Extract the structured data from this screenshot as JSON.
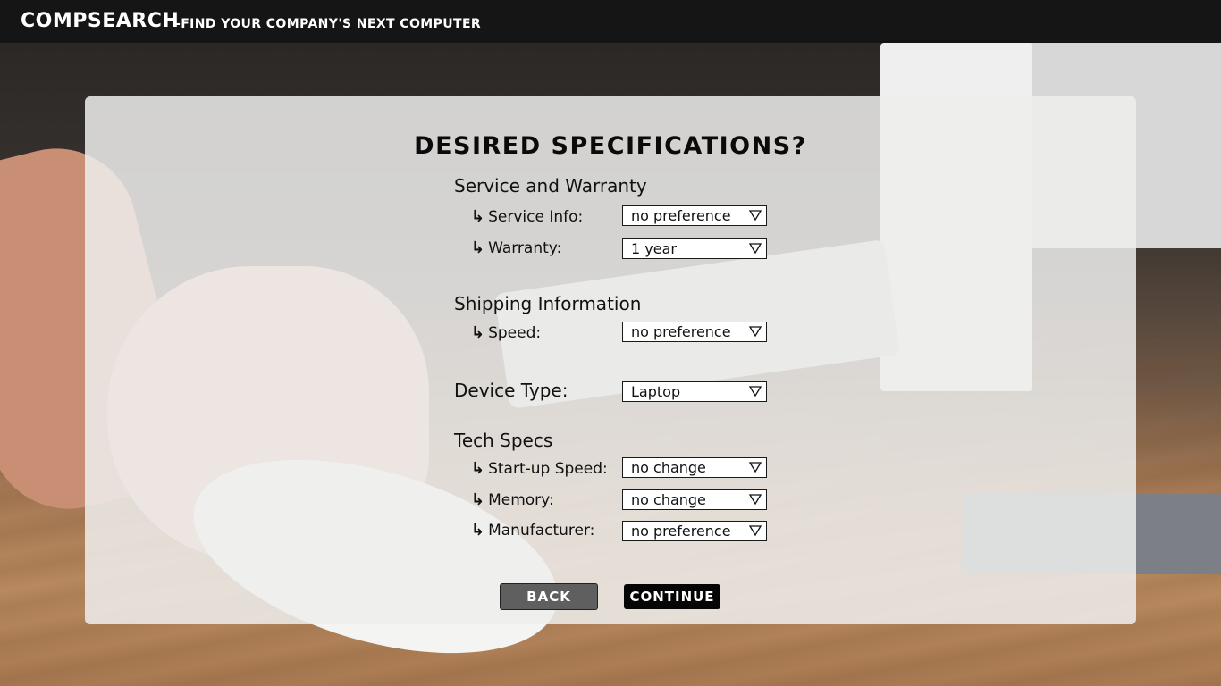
{
  "header": {
    "brand": "COMPSEARCH",
    "tagline": "-find your company's next computer"
  },
  "form": {
    "title": "DESIRED SPECIFICATIONS?",
    "sections": {
      "service": {
        "title": "Service and Warranty",
        "service_info": {
          "label": "Service Info:",
          "value": "no preference"
        },
        "warranty": {
          "label": "Warranty:",
          "value": "1 year"
        }
      },
      "shipping": {
        "title": "Shipping Information",
        "speed": {
          "label": "Speed:",
          "value": "no preference"
        }
      },
      "device": {
        "title": "Device Type:",
        "value": "Laptop"
      },
      "tech": {
        "title": "Tech Specs",
        "startup": {
          "label": "Start-up Speed:",
          "value": "no change"
        },
        "memory": {
          "label": "Memory:",
          "value": "no change"
        },
        "manufacturer": {
          "label": "Manufacturer:",
          "value": "no preference"
        }
      }
    },
    "buttons": {
      "back": "BACK",
      "continue": "CONTINUE"
    }
  },
  "icons": {
    "sub_item": "arrow-turn-right-icon",
    "dropdown": "triangle-down-icon"
  },
  "colors": {
    "header_bg": "#151515",
    "back_button": "#5f5f5f",
    "continue_button": "#050505"
  }
}
